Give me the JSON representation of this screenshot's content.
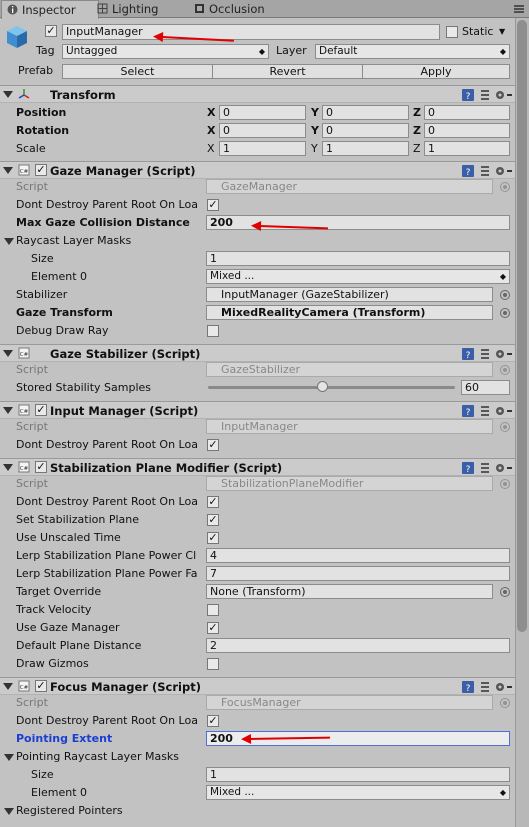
{
  "tabs": [
    {
      "label": "Inspector",
      "icon": "info-icon"
    },
    {
      "label": "Lighting",
      "icon": "lighting-icon"
    },
    {
      "label": "Occlusion",
      "icon": "occlusion-icon"
    }
  ],
  "gameobject": {
    "name": "InputManager",
    "active": true,
    "static_label": "Static",
    "static": false,
    "tag_label": "Tag",
    "tag": "Untagged",
    "layer_label": "Layer",
    "layer": "Default",
    "prefab_label": "Prefab",
    "select_label": "Select",
    "revert_label": "Revert",
    "apply_label": "Apply"
  },
  "transform": {
    "title": "Transform",
    "position_label": "Position",
    "rotation_label": "Rotation",
    "scale_label": "Scale",
    "x_label": "X",
    "y_label": "Y",
    "z_label": "Z",
    "position": [
      "0",
      "0",
      "0"
    ],
    "rotation": [
      "0",
      "0",
      "0"
    ],
    "scale": [
      "1",
      "1",
      "1"
    ]
  },
  "gaze_manager": {
    "title": "Gaze Manager (Script)",
    "script_label": "Script",
    "script": "GazeManager",
    "dont_destroy_label": "Dont Destroy Parent Root On Loa",
    "dont_destroy": true,
    "max_dist_label": "Max Gaze Collision Distance",
    "max_dist": "200",
    "raycast_label": "Raycast Layer Masks",
    "size_label": "Size",
    "size": "1",
    "element0_label": "Element 0",
    "element0": "Mixed ...",
    "stabilizer_label": "Stabilizer",
    "stabilizer": "InputManager (GazeStabilizer)",
    "gaze_transform_label": "Gaze Transform",
    "gaze_transform": "MixedRealityCamera (Transform)",
    "debug_label": "Debug Draw Ray",
    "debug": false
  },
  "gaze_stabilizer": {
    "title": "Gaze Stabilizer (Script)",
    "script_label": "Script",
    "script": "GazeStabilizer",
    "samples_label": "Stored Stability Samples",
    "samples": "60",
    "slider_fraction": 0.46
  },
  "input_manager": {
    "title": "Input Manager (Script)",
    "script_label": "Script",
    "script": "InputManager",
    "dont_destroy_label": "Dont Destroy Parent Root On Loa",
    "dont_destroy": true
  },
  "stab_plane": {
    "title": "Stabilization Plane Modifier (Script)",
    "script_label": "Script",
    "script": "StabilizationPlaneModifier",
    "dont_destroy_label": "Dont Destroy Parent Root On Loa",
    "set_plane_label": "Set Stabilization Plane",
    "unscaled_label": "Use Unscaled Time",
    "lerp_close_label": "Lerp Stabilization Plane Power Cl",
    "lerp_close": "4",
    "lerp_far_label": "Lerp Stabilization Plane Power Fa",
    "lerp_far": "7",
    "target_label": "Target Override",
    "target": "None (Transform)",
    "track_label": "Track Velocity",
    "use_gaze_label": "Use Gaze Manager",
    "default_dist_label": "Default Plane Distance",
    "default_dist": "2",
    "gizmos_label": "Draw Gizmos"
  },
  "focus_manager": {
    "title": "Focus Manager (Script)",
    "script_label": "Script",
    "script": "FocusManager",
    "dont_destroy_label": "Dont Destroy Parent Root On Loa",
    "pointing_label": "Pointing Extent",
    "pointing": "200",
    "raycast_label": "Pointing Raycast Layer Masks",
    "size_label": "Size",
    "size": "1",
    "element0_label": "Element 0",
    "element0": "Mixed ...",
    "registered_label": "Registered Pointers"
  },
  "colors": {
    "annotation_arrow": "#e00000",
    "focus_border": "#4d6fd6",
    "highlight_label": "#1a3fd4"
  }
}
